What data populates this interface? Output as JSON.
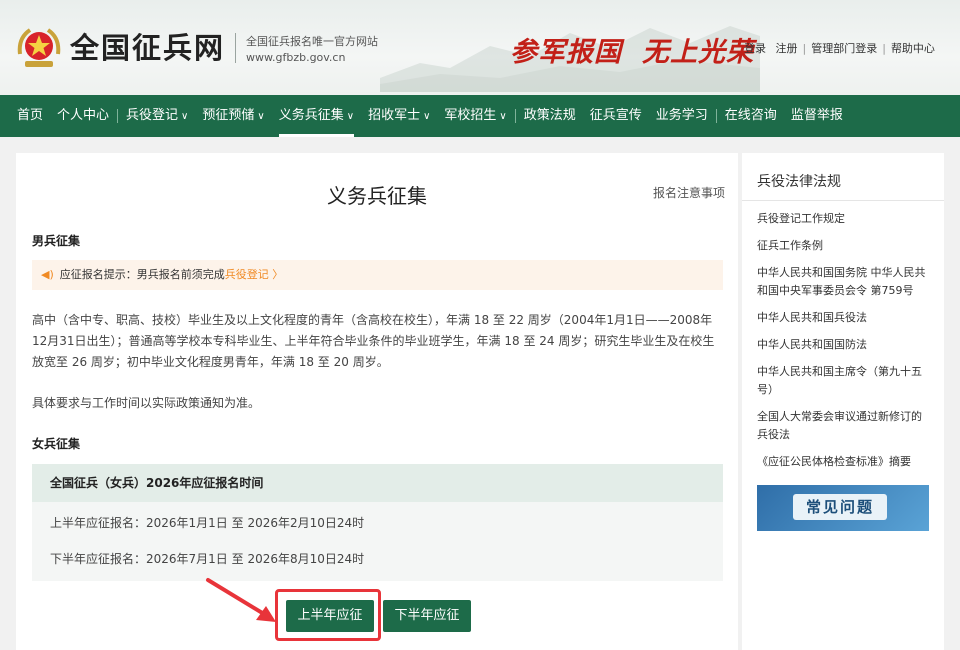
{
  "header": {
    "site_name": "全国征兵网",
    "tagline_1": "全国征兵报名唯一官方网站",
    "tagline_2": "www.gfbzb.gov.cn",
    "slogan_1": "参军报国",
    "slogan_2": "无上光荣",
    "links": {
      "login": "登录",
      "register": "注册",
      "admin_login": "管理部门登录",
      "help": "帮助中心"
    }
  },
  "nav": {
    "home": "首页",
    "personal": "个人中心",
    "registration": "兵役登记",
    "pre_storage": "预征预储",
    "conscription": "义务兵征集",
    "sergeant": "招收军士",
    "academy": "军校招生",
    "policy": "政策法规",
    "promo": "征兵宣传",
    "study": "业务学习",
    "consult": "在线咨询",
    "report": "监督举报"
  },
  "main": {
    "title": "义务兵征集",
    "notice_link": "报名注意事项",
    "male_title": "男兵征集",
    "tip_text": "应征报名提示：男兵报名前须完成",
    "tip_link": "兵役登记 〉",
    "male_para": "高中（含中专、职高、技校）毕业生及以上文化程度的青年（含高校在校生），年满 18 至 22 周岁（2004年1月1日——2008年12月31日出生）；普通高等学校本专科毕业生、上半年符合毕业条件的毕业班学生，年满 18 至 24 周岁；研究生毕业生及在校生放宽至 26 周岁；初中毕业文化程度男青年，年满 18 至 20 周岁。",
    "male_note": "具体要求与工作时间以实际政策通知为准。",
    "female_title": "女兵征集",
    "table_header": "全国征兵（女兵）2026年应征报名时间",
    "row_1": "上半年应征报名：2026年1月1日 至 2026年2月10日24时",
    "row_2": "下半年应征报名：2026年7月1日 至 2026年8月10日24时",
    "btn_first": "上半年应征",
    "btn_second": "下半年应征"
  },
  "sidebar": {
    "title": "兵役法律法规",
    "items": [
      "兵役登记工作规定",
      "征兵工作条例",
      "中华人民共和国国务院 中华人民共和国中央军事委员会令 第759号",
      "中华人民共和国兵役法",
      "中华人民共和国国防法",
      "中华人民共和国主席令（第九十五号）",
      "全国人大常委会审议通过新修订的兵役法",
      "《应征公民体格检查标准》摘要"
    ],
    "faq_label": "常见问题"
  },
  "colors": {
    "primary_green": "#1d6b49",
    "slogan_red": "#c22018",
    "tip_orange": "#f08a24",
    "highlight_red": "#e8343a"
  }
}
